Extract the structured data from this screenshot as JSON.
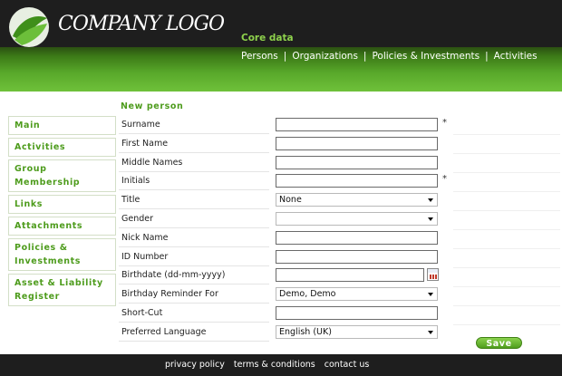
{
  "header": {
    "logo_text": "COMPANY LOGO",
    "section_title": "Core data",
    "nav": [
      "Persons",
      "Organizations",
      "Policies & Investments",
      "Activities"
    ]
  },
  "form_heading": "New person",
  "sidebar": {
    "items": [
      {
        "label": "Main"
      },
      {
        "label": "Activities"
      },
      {
        "label": "Group\nMembership"
      },
      {
        "label": "Links"
      },
      {
        "label": "Attachments"
      },
      {
        "label": "Policies &\nInvestments"
      },
      {
        "label": "Asset & Liability\nRegister"
      }
    ]
  },
  "fields": {
    "surname": {
      "label": "Surname",
      "value": "",
      "required_mark": "*"
    },
    "first_name": {
      "label": "First Name",
      "value": ""
    },
    "middle_names": {
      "label": "Middle Names",
      "value": ""
    },
    "initials": {
      "label": "Initials",
      "value": "",
      "required_mark": "*"
    },
    "title": {
      "label": "Title",
      "value": "None"
    },
    "gender": {
      "label": "Gender",
      "value": ""
    },
    "nick_name": {
      "label": "Nick Name",
      "value": ""
    },
    "id_number": {
      "label": "ID Number",
      "value": ""
    },
    "birthdate": {
      "label": "Birthdate (dd-mm-yyyy)",
      "value": ""
    },
    "birthday_reminder": {
      "label": "Birthday Reminder For",
      "value": "Demo, Demo"
    },
    "short_cut": {
      "label": "Short-Cut",
      "value": ""
    },
    "preferred_language": {
      "label": "Preferred Language",
      "value": "English (UK)"
    }
  },
  "save_label": "Save",
  "footer": {
    "links": [
      "privacy policy",
      "terms & conditions",
      "contact us"
    ]
  },
  "colors": {
    "accent_green": "#4e9c1d",
    "header_dark": "#1e1e1e",
    "nav_green": "#8ed14c"
  }
}
